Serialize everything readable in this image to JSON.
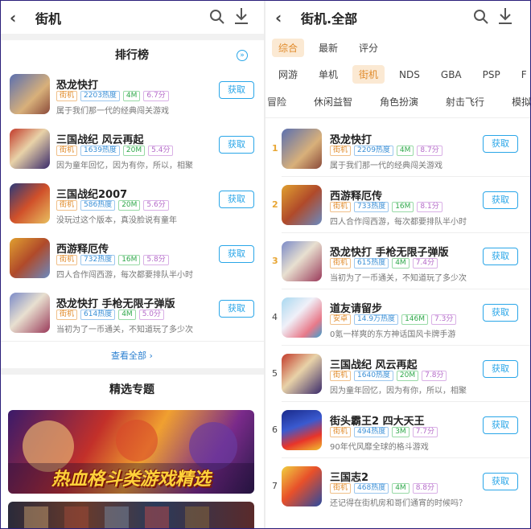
{
  "left": {
    "header": {
      "back": "‹",
      "title": "街机"
    },
    "ranking": {
      "title": "排行榜",
      "view_all": "查看全部",
      "items": [
        {
          "name": "恐龙快打",
          "cat": "街机",
          "heat": "2203热度",
          "size": "4M",
          "score": "6.7分",
          "desc": "属于我们那一代的经典闯关游戏",
          "action": "获取"
        },
        {
          "name": "三国战纪 风云再起",
          "cat": "街机",
          "heat": "1639热度",
          "size": "20M",
          "score": "5.4分",
          "desc": "因为童年回忆，因为有你，所以，相聚",
          "action": "获取"
        },
        {
          "name": "三国战纪2007",
          "cat": "街机",
          "heat": "586热度",
          "size": "20M",
          "score": "5.6分",
          "desc": "没玩过这个版本，真没脸说有童年",
          "action": "获取"
        },
        {
          "name": "西游释厄传",
          "cat": "街机",
          "heat": "732热度",
          "size": "16M",
          "score": "5.8分",
          "desc": "四人合作闯西游，每次都要排队半小时",
          "action": "获取"
        },
        {
          "name": "恐龙快打 手枪无限子弹版",
          "cat": "街机",
          "heat": "614热度",
          "size": "4M",
          "score": "5.0分",
          "desc": "当初为了一币通关，不知道玩了多少次",
          "action": "获取"
        }
      ]
    },
    "featured": {
      "title": "精选专题",
      "banner_text": "热血格斗类游戏精选"
    }
  },
  "right": {
    "header": {
      "back": "‹",
      "title": "街机.全部"
    },
    "sort_tabs": [
      "综合",
      "最新",
      "评分"
    ],
    "platform_tabs": [
      "网游",
      "单机",
      "街机",
      "NDS",
      "GBA",
      "PSP",
      "F"
    ],
    "genre_tabs": [
      "冒险",
      "休闲益智",
      "角色扮演",
      "射击飞行",
      "模拟游戏"
    ],
    "items": [
      {
        "rank": "1",
        "name": "恐龙快打",
        "cat": "街机",
        "heat": "2209热度",
        "size": "4M",
        "score": "8.7分",
        "desc": "属于我们那一代的经典闯关游戏",
        "action": "获取"
      },
      {
        "rank": "2",
        "name": "西游释厄传",
        "cat": "街机",
        "heat": "733热度",
        "size": "16M",
        "score": "8.1分",
        "desc": "四人合作闯西游，每次都要排队半小时",
        "action": "获取"
      },
      {
        "rank": "3",
        "name": "恐龙快打 手枪无限子弹版",
        "cat": "街机",
        "heat": "615热度",
        "size": "4M",
        "score": "7.4分",
        "desc": "当初为了一币通关，不知道玩了多少次",
        "action": "获取"
      },
      {
        "rank": "4",
        "name": "道友请留步",
        "cat": "安卓",
        "heat": "14.9万热度",
        "size": "146M",
        "score": "7.3分",
        "desc": "0氪一样爽的东方神话国风卡牌手游",
        "action": "获取"
      },
      {
        "rank": "5",
        "name": "三国战纪 风云再起",
        "cat": "街机",
        "heat": "1640热度",
        "size": "20M",
        "score": "7.8分",
        "desc": "因为童年回忆，因为有你，所以，相聚",
        "action": "获取"
      },
      {
        "rank": "6",
        "name": "街头霸王2 四大天王",
        "cat": "街机",
        "heat": "494热度",
        "size": "3M",
        "score": "7.7分",
        "desc": "90年代风靡全球的格斗游戏",
        "action": "获取"
      },
      {
        "rank": "7",
        "name": "三国志2",
        "cat": "街机",
        "heat": "468热度",
        "size": "4M",
        "score": "8.8分",
        "desc": "还记得在街机房和哥们通宵的时候吗？",
        "action": "获取"
      }
    ]
  }
}
